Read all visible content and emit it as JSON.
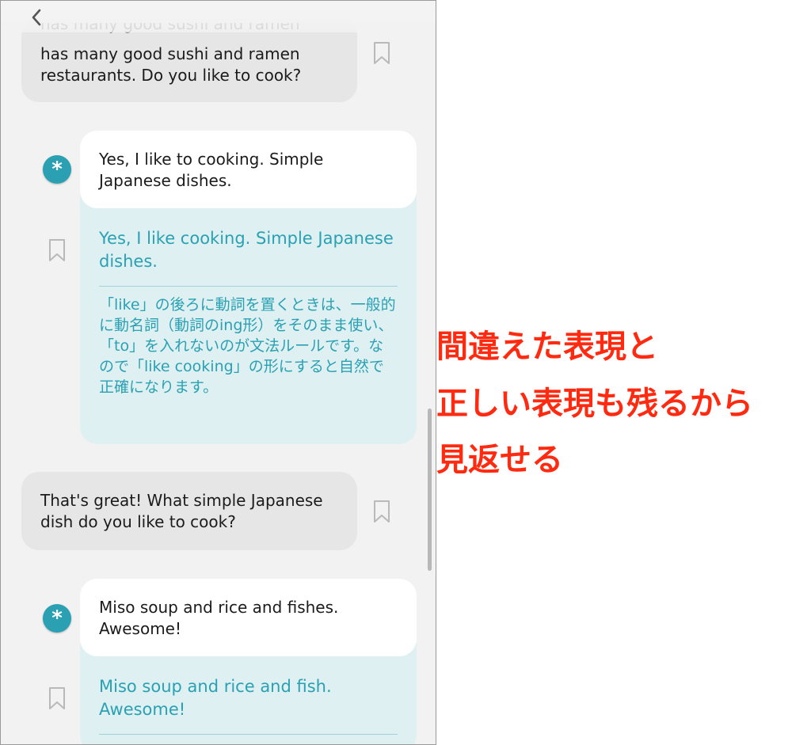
{
  "nav": {
    "back_label": "<"
  },
  "messages": [
    {
      "role": "ai",
      "text_partial": "has many good sushi and ramen restaurants. Do you like to cook?"
    },
    {
      "role": "user",
      "avatar_glyph": "*",
      "original": "Yes, I like to cooking. Simple Japanese dishes.",
      "corrected": "Yes, I like cooking. Simple Japanese dishes.",
      "explanation": "「like」の後ろに動詞を置くときは、一般的に動名詞（動詞のing形）をそのまま使い、「to」を入れないのが文法ルールです。なので「like cooking」の形にすると自然で正確になります。"
    },
    {
      "role": "ai",
      "text": "That's great! What simple Japanese dish do you like to cook?"
    },
    {
      "role": "user",
      "avatar_glyph": "*",
      "original": "Miso soup and rice and fishes. Awesome!",
      "corrected": "Miso soup and rice and fish. Awesome!"
    }
  ],
  "annotation": {
    "line1": "間違えた表現と",
    "line2": "正しい表現も残るから",
    "line3": "見返せる"
  },
  "colors": {
    "accent": "#2aa0b2",
    "ai_bubble": "#e6e6e6",
    "correction_bg": "#dff0f3",
    "annotation": "#ff2a10"
  },
  "icons": [
    "chevron-left-icon",
    "bookmark-icon",
    "asterisk-avatar-icon"
  ]
}
